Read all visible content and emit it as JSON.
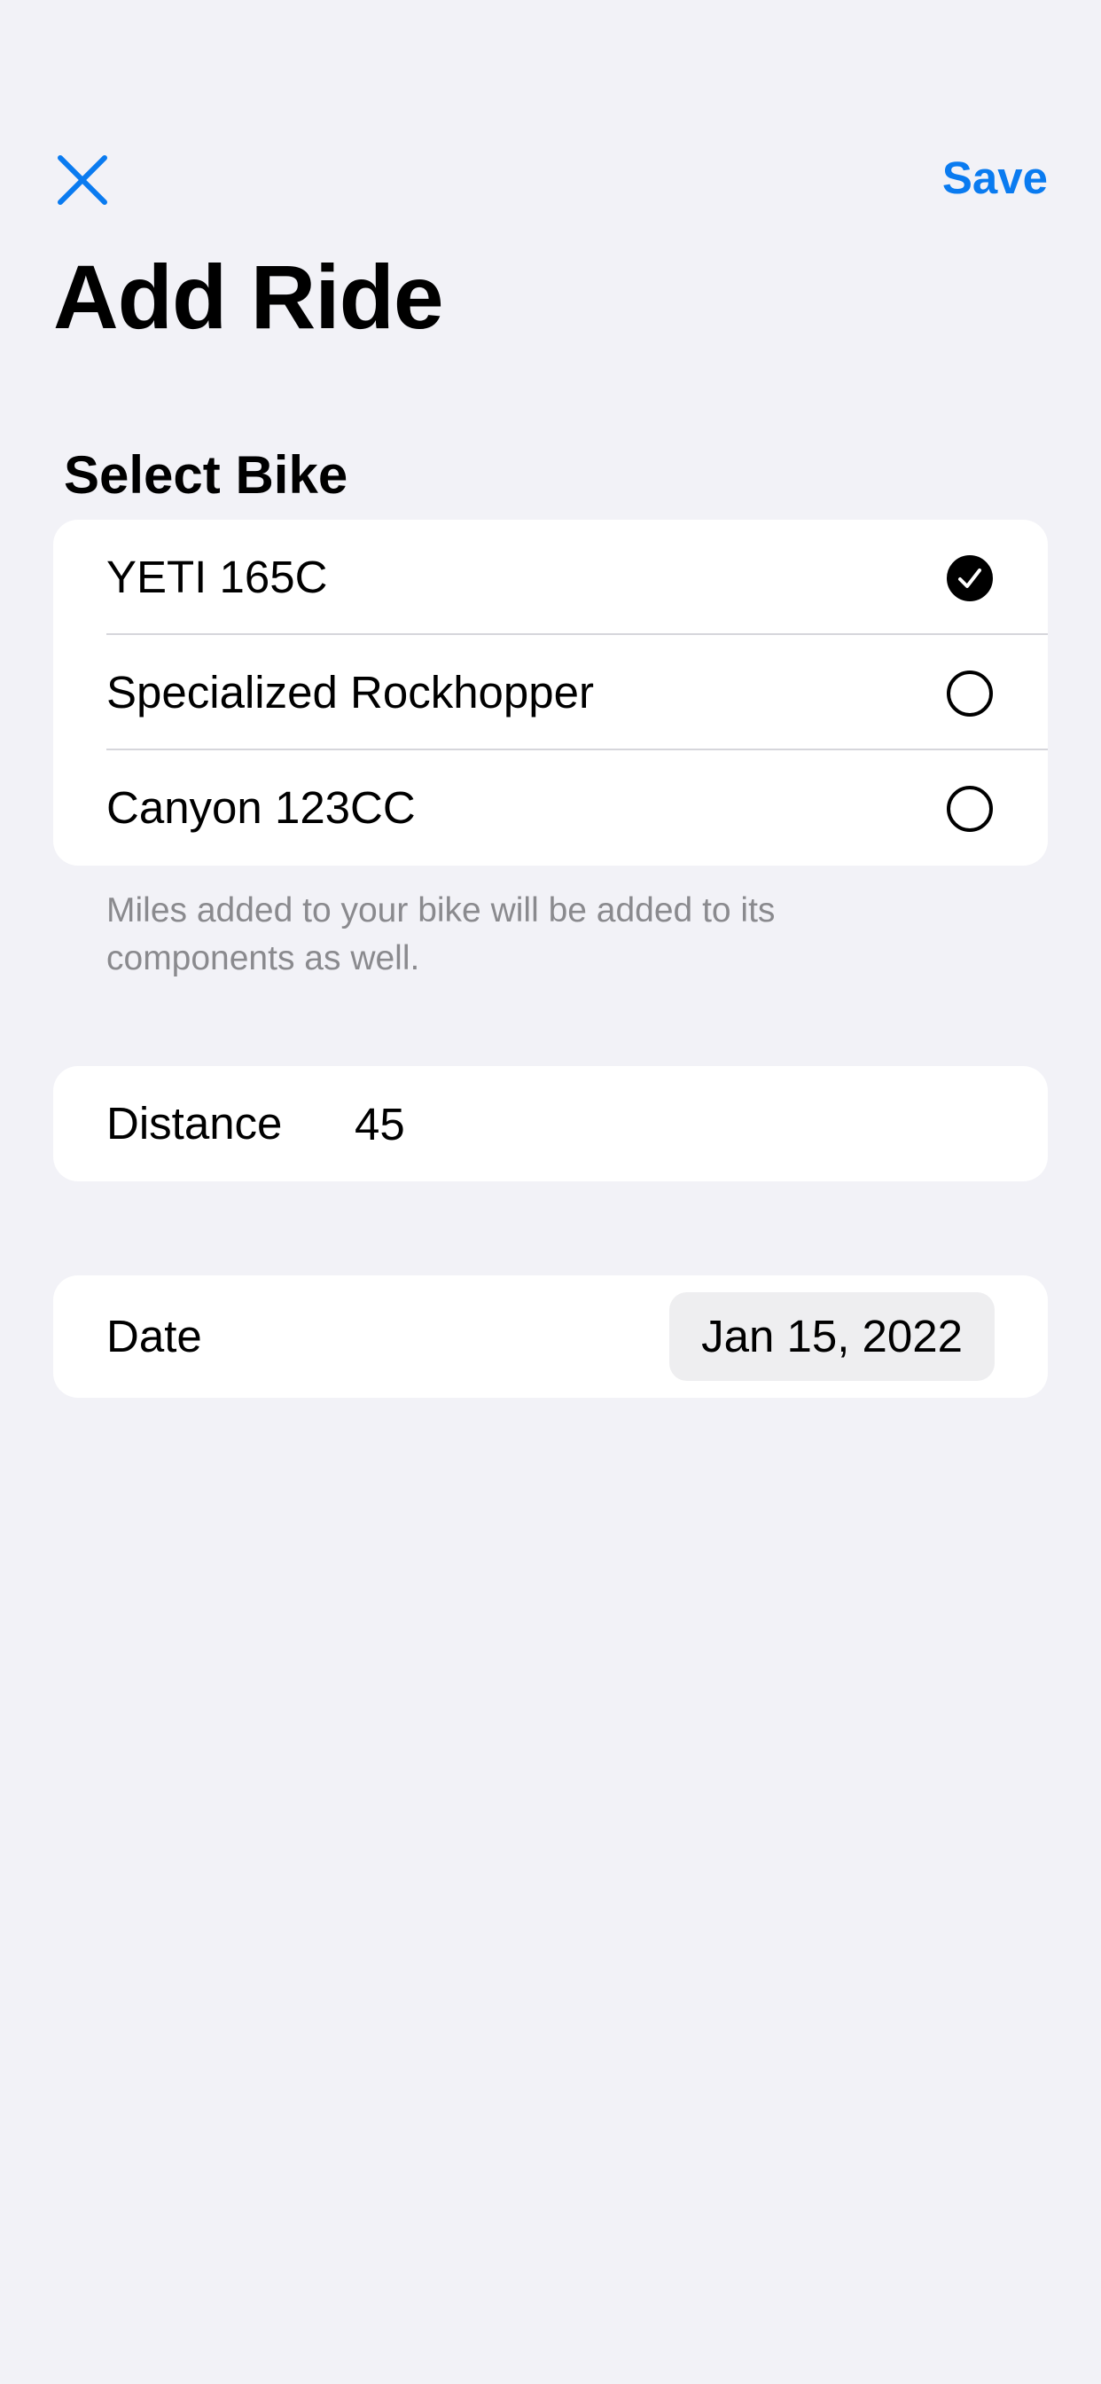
{
  "nav": {
    "close_icon": "close-icon",
    "save_label": "Save",
    "accent_color": "#0a7bf0"
  },
  "title": "Add Ride",
  "bike_section": {
    "header": "Select Bike",
    "bikes": [
      {
        "label": "YETI 165C",
        "selected": true
      },
      {
        "label": "Specialized Rockhopper",
        "selected": false
      },
      {
        "label": "Canyon 123CC",
        "selected": false
      }
    ],
    "footer_note": "Miles added to your bike will be added to its components as well."
  },
  "distance": {
    "label": "Distance",
    "value": "45"
  },
  "date": {
    "label": "Date",
    "value": "Jan 15, 2022"
  }
}
